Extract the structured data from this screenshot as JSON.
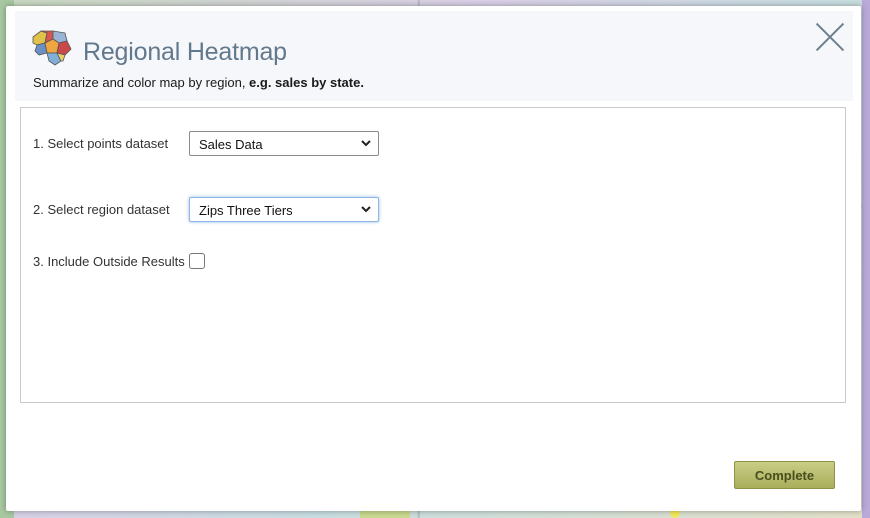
{
  "modal": {
    "title": "Regional Heatmap",
    "subtitle_prefix": "Summarize and color map by region, ",
    "subtitle_bold": "e.g. sales by state.",
    "icon": "us-map-icon",
    "close_icon": "close-icon"
  },
  "form": {
    "points_label": "1. Select points dataset",
    "points_value": "Sales Data",
    "region_label": "2. Select region dataset",
    "region_value": "Zips Three Tiers",
    "outside_label": "3. Include Outside Results",
    "outside_checked": false
  },
  "footer": {
    "complete_label": "Complete"
  },
  "colors": {
    "title": "#62788d",
    "button": "#b8bc6e",
    "focus": "#8fb7e6"
  }
}
